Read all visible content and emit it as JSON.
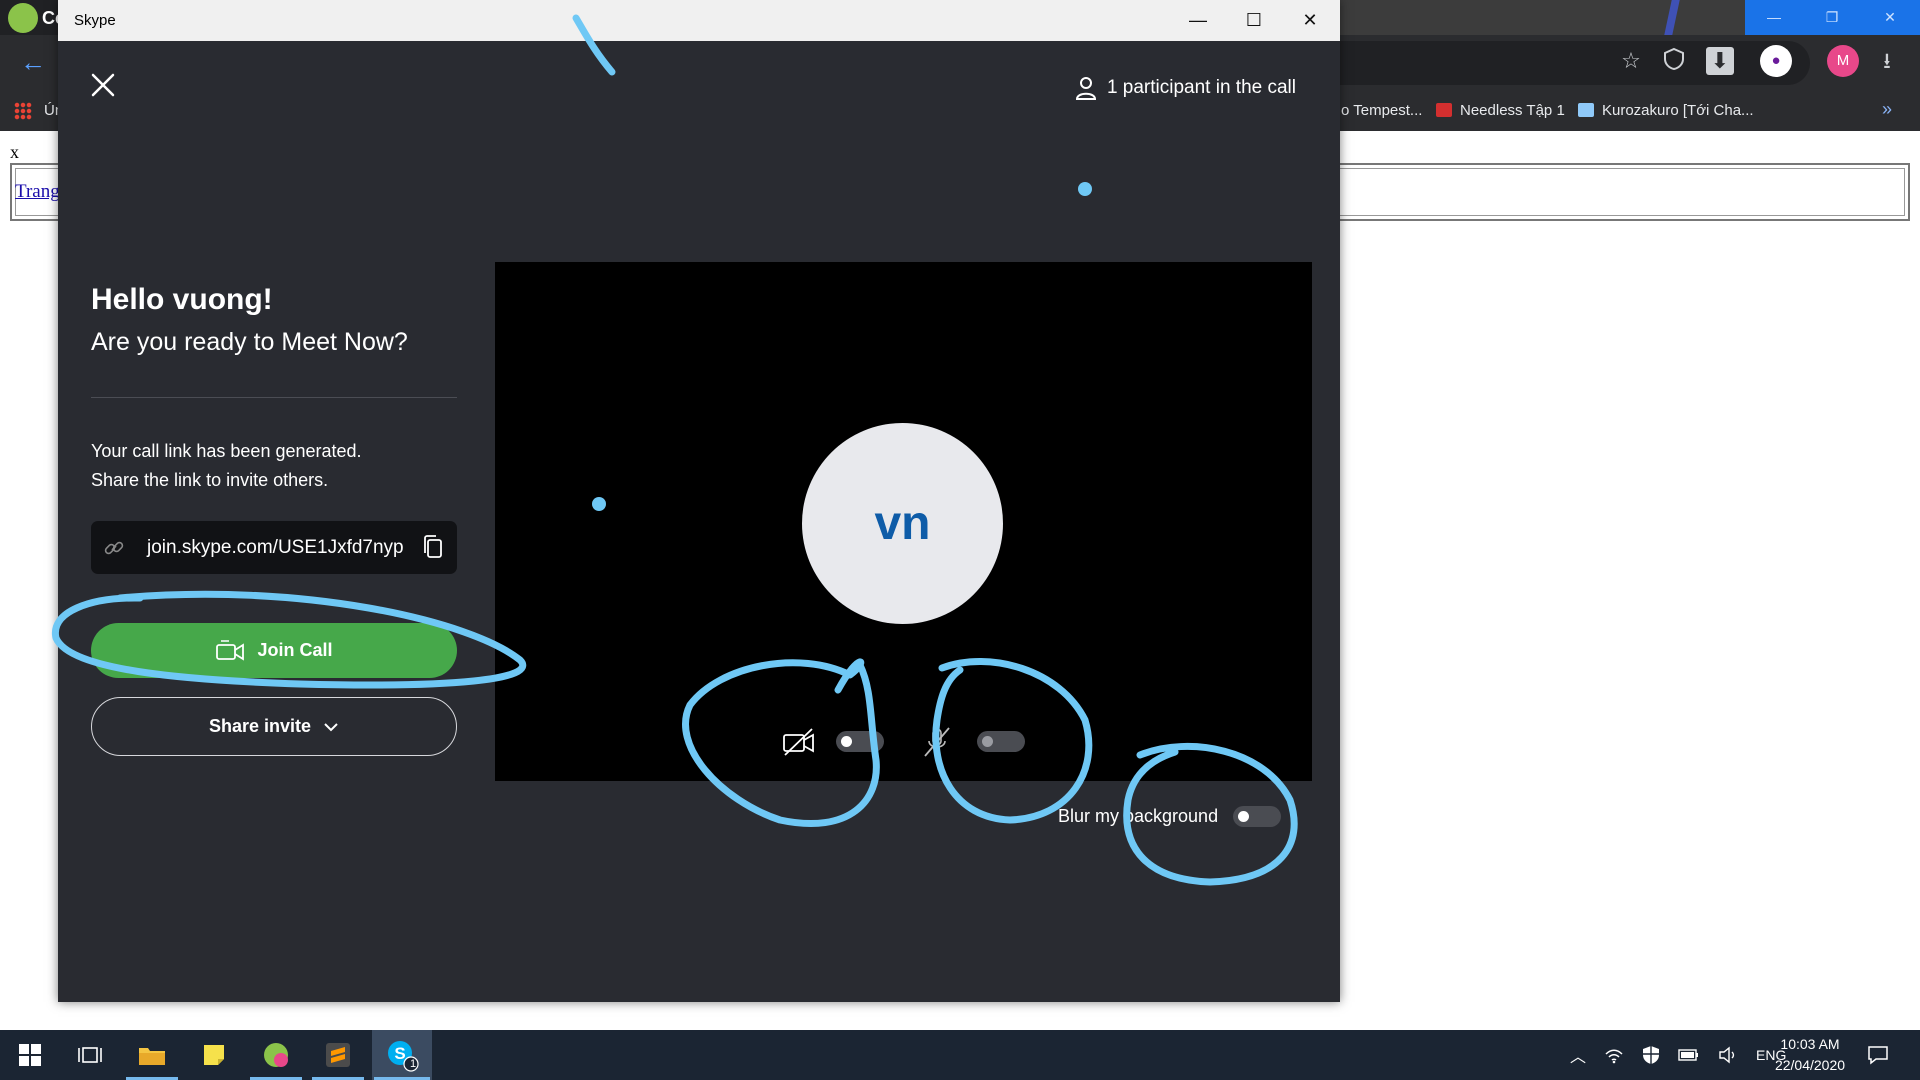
{
  "browser": {
    "bookmarks": [
      {
        "label": "Ún",
        "color": "#4caf50"
      },
      {
        "label": "o Tempest...",
        "color": ""
      },
      {
        "label": "Needless Tập 1",
        "color": "#d32f2f"
      },
      {
        "label": "Kurozakuro [Tới Cha...",
        "color": "#90caf9"
      }
    ],
    "more_bookmarks": "»",
    "profile_initial": "M",
    "page": {
      "x_text": "x",
      "link_text": "Trang"
    }
  },
  "skype": {
    "window_title": "Skype",
    "participants_text": "1 participant in the call",
    "greeting": "Hello vuong!",
    "subtitle": "Are you ready to Meet Now?",
    "link_message_line1": "Your call link has been generated.",
    "link_message_line2": "Share the link to invite others.",
    "call_link": "join.skype.com/USE1Jxfd7nyp",
    "join_label": "Join Call",
    "share_label": "Share invite",
    "avatar_initials": "vn",
    "video_toggle": false,
    "mic_toggle": false,
    "blur_label": "Blur my background",
    "blur_toggle": false,
    "colors": {
      "background": "#292b31",
      "join_green": "#46a84a",
      "avatar_text": "#0e5ca8",
      "annotation": "#6fc8f5"
    }
  },
  "taskbar": {
    "language": "ENG",
    "time": "10:03 AM",
    "date": "22/04/2020",
    "skype_badge": "1"
  }
}
